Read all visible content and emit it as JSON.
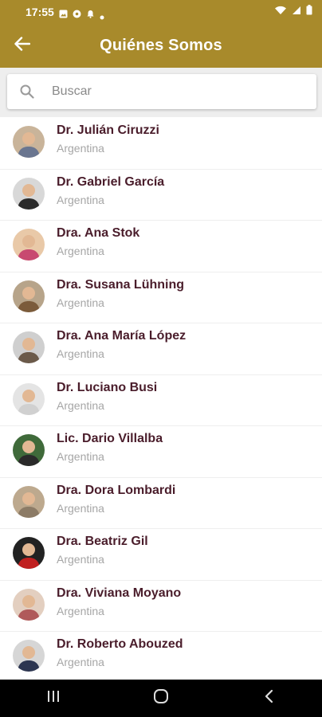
{
  "colors": {
    "primary": "#a88a2b",
    "name_text": "#4a1d2b",
    "secondary_text": "#a6a6a6",
    "nav_bar": "#000000"
  },
  "status_bar": {
    "time": "17:55",
    "icons_left": [
      "gallery-icon",
      "soccer-ball-icon",
      "notification-bell-icon",
      "dot-icon"
    ],
    "icons_right": [
      "wifi-icon",
      "signal-icon",
      "battery-icon"
    ]
  },
  "app_bar": {
    "back_icon": "arrow-left-icon",
    "title": "Quiénes Somos"
  },
  "search": {
    "icon": "search-icon",
    "placeholder": "Buscar",
    "value": ""
  },
  "people": [
    {
      "name": "Dr. Julián Ciruzzi",
      "country": "Argentina",
      "avatar_bg": "#c9b49a",
      "avatar_shirt": "#6a7690"
    },
    {
      "name": "Dr. Gabriel García",
      "country": "Argentina",
      "avatar_bg": "#d8d8d8",
      "avatar_shirt": "#2b2b2b"
    },
    {
      "name": "Dra. Ana Stok",
      "country": "Argentina",
      "avatar_bg": "#e9c9a8",
      "avatar_shirt": "#c84a70"
    },
    {
      "name": "Dra. Susana Lühning",
      "country": "Argentina",
      "avatar_bg": "#b7a48a",
      "avatar_shirt": "#7b5b3b"
    },
    {
      "name": "Dra. Ana María López",
      "country": "Argentina",
      "avatar_bg": "#cfcfcf",
      "avatar_shirt": "#6b5a4a"
    },
    {
      "name": "Dr. Luciano Busi",
      "country": "Argentina",
      "avatar_bg": "#e4e4e4",
      "avatar_shirt": "#d0d0d0"
    },
    {
      "name": "Lic. Dario Villalba",
      "country": "Argentina",
      "avatar_bg": "#3f6a3a",
      "avatar_shirt": "#2a2a2a"
    },
    {
      "name": "Dra. Dora Lombardi",
      "country": "Argentina",
      "avatar_bg": "#bda98e",
      "avatar_shirt": "#8c7b66"
    },
    {
      "name": "Dra. Beatriz Gil",
      "country": "Argentina",
      "avatar_bg": "#222222",
      "avatar_shirt": "#c02020"
    },
    {
      "name": "Dra. Viviana Moyano",
      "country": "Argentina",
      "avatar_bg": "#e3cfc0",
      "avatar_shirt": "#b05a5a"
    },
    {
      "name": "Dr. Roberto Abouzed",
      "country": "Argentina",
      "avatar_bg": "#d6d6d6",
      "avatar_shirt": "#2c3550"
    }
  ],
  "nav_bar": {
    "recents_icon": "recent-apps-icon",
    "home_icon": "home-circle-icon",
    "back_icon": "nav-back-icon"
  }
}
